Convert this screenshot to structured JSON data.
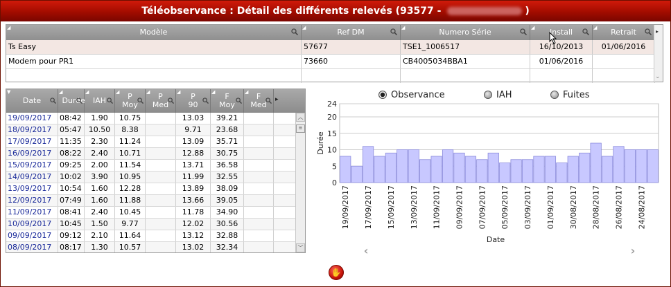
{
  "window": {
    "title": "Téléobservance : Détail des différents relevés (93577 - ",
    "title_end": ")"
  },
  "top_table": {
    "columns": [
      "Modèle",
      "Ref DM",
      "Numero Série",
      "Install",
      "Retrait"
    ],
    "rows": [
      [
        "Ts Easy",
        "57677",
        "TSE1_1006517",
        "16/10/2013",
        "01/06/2016"
      ],
      [
        "Modem pour PR1",
        "73660",
        "CB4005034BBA1",
        "01/06/2016",
        ""
      ]
    ]
  },
  "left_table": {
    "columns": [
      "Date",
      "Durée",
      "IAH",
      "P Moy",
      "P Med",
      "P 90",
      "F Moy",
      "F Med"
    ],
    "rows": [
      [
        "19/09/2017",
        "08:42",
        "1.90",
        "10.75",
        "",
        "13.03",
        "39.21",
        ""
      ],
      [
        "18/09/2017",
        "05:47",
        "10.50",
        "8.38",
        "",
        "9.71",
        "23.68",
        ""
      ],
      [
        "17/09/2017",
        "11:35",
        "2.30",
        "11.24",
        "",
        "13.09",
        "35.71",
        ""
      ],
      [
        "16/09/2017",
        "08:22",
        "2.40",
        "10.71",
        "",
        "12.88",
        "30.75",
        ""
      ],
      [
        "15/09/2017",
        "09:25",
        "2.00",
        "11.54",
        "",
        "13.71",
        "36.58",
        ""
      ],
      [
        "14/09/2017",
        "10:02",
        "3.90",
        "10.95",
        "",
        "11.99",
        "32.55",
        ""
      ],
      [
        "13/09/2017",
        "10:54",
        "1.60",
        "12.28",
        "",
        "13.89",
        "38.09",
        ""
      ],
      [
        "12/09/2017",
        "07:49",
        "1.60",
        "11.88",
        "",
        "13.66",
        "39.05",
        ""
      ],
      [
        "11/09/2017",
        "08:41",
        "2.40",
        "10.45",
        "",
        "11.78",
        "34.90",
        ""
      ],
      [
        "10/09/2017",
        "10:45",
        "1.50",
        "9.77",
        "",
        "12.02",
        "30.56",
        ""
      ],
      [
        "09/09/2017",
        "09:12",
        "2.10",
        "11.64",
        "",
        "13.12",
        "32.88",
        ""
      ],
      [
        "08/09/2017",
        "08:17",
        "1.30",
        "10.57",
        "",
        "13.02",
        "32.34",
        ""
      ]
    ]
  },
  "legend": {
    "selected": "Observance",
    "options": [
      "Observance",
      "IAH",
      "Fuites"
    ]
  },
  "colors": {
    "title_bar": "#b01208",
    "bar_fill": "#c8c8ff",
    "bar_stroke": "#8c8cdc",
    "date_link": "#1a2a9a"
  },
  "chart_data": {
    "type": "bar",
    "ylabel": "Durée",
    "xlabel": "Date",
    "ylim": [
      0,
      24
    ],
    "yticks": [
      0,
      5,
      10,
      15,
      20,
      24
    ],
    "grid": true,
    "categories": [
      "19/09/2017",
      "18/09/2017",
      "17/09/2017",
      "16/09/2017",
      "15/09/2017",
      "14/09/2017",
      "13/09/2017",
      "12/09/2017",
      "11/09/2017",
      "10/09/2017",
      "09/09/2017",
      "08/09/2017",
      "07/09/2017",
      "06/09/2017",
      "05/09/2017",
      "04/09/2017",
      "03/09/2017",
      "02/09/2017",
      "01/09/2017",
      "31/08/2017",
      "30/08/2017",
      "29/08/2017",
      "28/08/2017",
      "27/08/2017",
      "26/08/2017",
      "25/08/2017",
      "24/08/2017",
      "23/08/2017"
    ],
    "tick_labels": [
      "19/09/2017",
      "17/09/2017",
      "15/09/2017",
      "13/09/2017",
      "11/09/2017",
      "09/09/2017",
      "07/09/2017",
      "05/09/2017",
      "03/09/2017",
      "01/09/2017",
      "30/08/2017",
      "28/08/2017",
      "26/08/2017",
      "24/08/2017"
    ],
    "values": [
      8,
      5,
      11,
      8,
      9,
      10,
      10,
      7,
      8,
      10,
      9,
      8,
      7,
      9,
      6,
      7,
      7,
      8,
      8,
      6,
      8,
      9,
      12,
      8,
      11,
      10,
      10,
      10
    ]
  }
}
